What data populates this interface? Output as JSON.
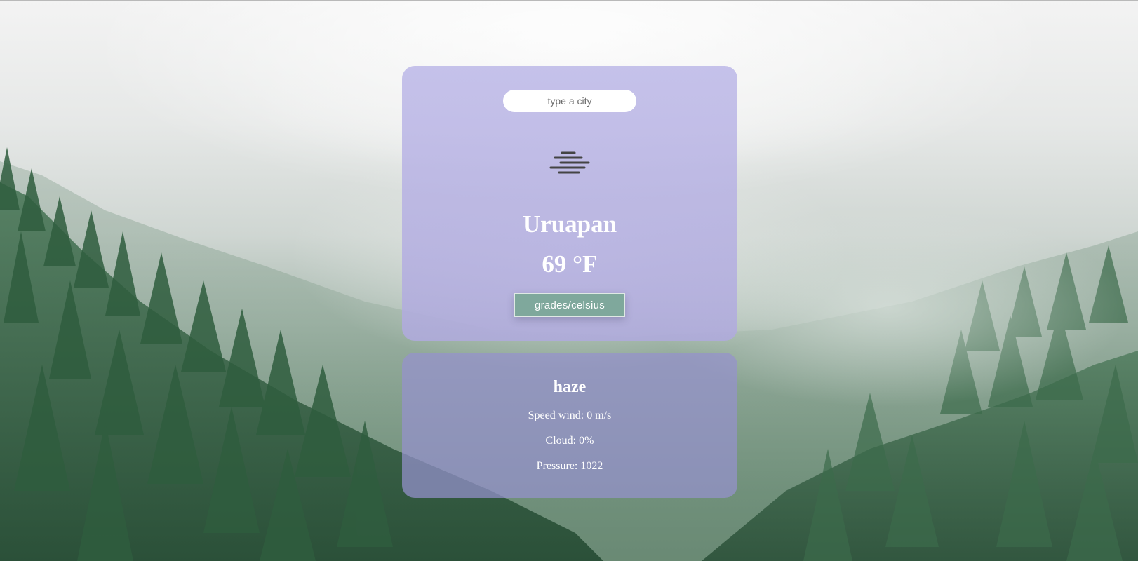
{
  "search": {
    "placeholder": "type a city",
    "value": ""
  },
  "weather": {
    "icon": "haze-icon",
    "city": "Uruapan",
    "temperature": "69 °F",
    "unit_toggle_label": "grades/celsius"
  },
  "details": {
    "condition": "haze",
    "wind": "Speed wind: 0 m/s",
    "cloud": "Cloud: 0%",
    "pressure": "Pressure: 1022"
  },
  "colors": {
    "main_card": "#bdb9e6",
    "details_card": "#9692cd",
    "toggle_button": "#7fa89c",
    "text": "#ffffff"
  }
}
